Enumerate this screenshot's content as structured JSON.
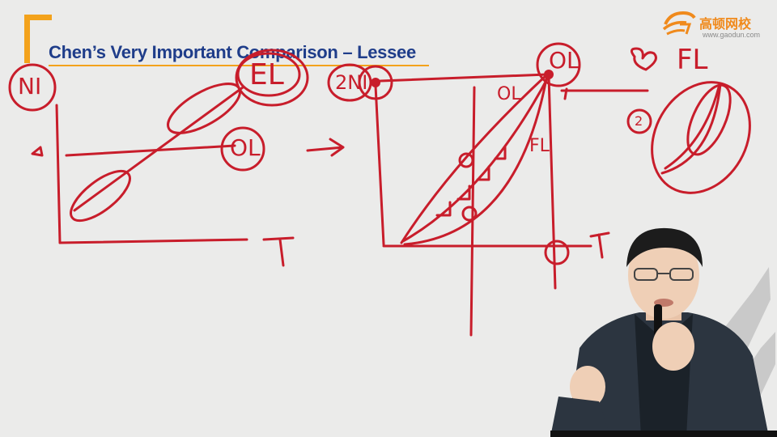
{
  "slide": {
    "title": "Chen’s Very Important Comparison – Lessee"
  },
  "logo": {
    "chinese_name": "高顿网校",
    "url": "www.gaodun.com"
  },
  "handwriting": {
    "ni_label": "NI",
    "el_label": "EL",
    "ol_left": "OL",
    "t_left": "T",
    "arrow_text": "→",
    "two_ni": "2NI",
    "ol_right_top": "OL",
    "ol_right_mid": "OL",
    "fl_right_mid": "FL",
    "fl_far": "FL",
    "t_right": "T",
    "circle_one": "1",
    "circle_two": "2"
  },
  "colors": {
    "ink": "#c81d2b",
    "title_blue": "#1f3d8a",
    "accent_orange": "#f3a21b",
    "background": "#ebebea"
  }
}
